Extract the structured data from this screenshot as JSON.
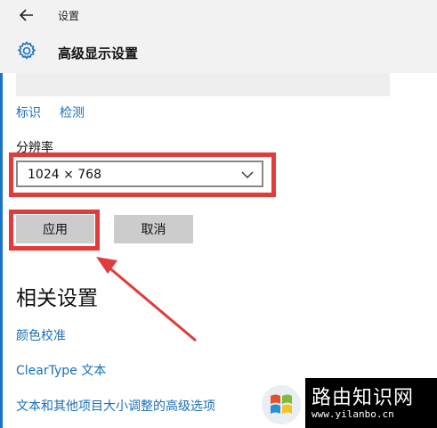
{
  "window": {
    "title": "设置"
  },
  "header": {
    "title": "高级显示设置"
  },
  "display_links": [
    "标识",
    "检测"
  ],
  "resolution": {
    "label": "分辨率",
    "value": "1024 × 768"
  },
  "buttons": {
    "apply": "应用",
    "cancel": "取消"
  },
  "related": {
    "title": "相关设置",
    "links": [
      "颜色校准",
      "ClearType 文本",
      "文本和其他项目大小调整的高级选项"
    ]
  },
  "watermark": {
    "title": "路由知识网",
    "url": "www.yilanbo.cn"
  },
  "colors": {
    "accent": "#1a6fb8",
    "highlight": "#e03c3c",
    "button": "#cccccc"
  }
}
